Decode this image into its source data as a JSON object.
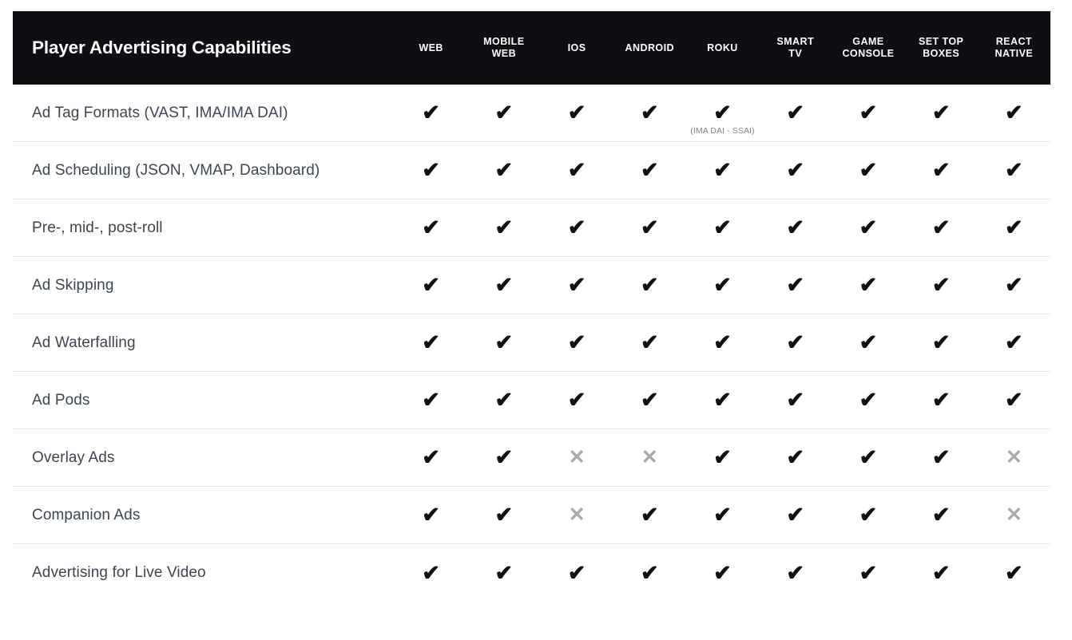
{
  "header": {
    "title": "Player Advertising Capabilities",
    "columns": [
      {
        "label": "WEB",
        "lines": [
          "WEB"
        ]
      },
      {
        "label": "MOBILE WEB",
        "lines": [
          "MOBILE",
          "WEB"
        ]
      },
      {
        "label": "IOS",
        "lines": [
          "IOS"
        ]
      },
      {
        "label": "ANDROID",
        "lines": [
          "ANDROID"
        ]
      },
      {
        "label": "ROKU",
        "lines": [
          "ROKU"
        ]
      },
      {
        "label": "SMART TV",
        "lines": [
          "SMART",
          "TV"
        ]
      },
      {
        "label": "GAME CONSOLE",
        "lines": [
          "GAME",
          "CONSOLE"
        ]
      },
      {
        "label": "SET TOP BOXES",
        "lines": [
          "SET TOP",
          "BOXES"
        ]
      },
      {
        "label": "REACT NATIVE",
        "lines": [
          "REACT",
          "NATIVE"
        ]
      }
    ],
    "background_color": "#0d0f12",
    "text_color": "#ffffff"
  },
  "icons": {
    "yes_glyph": "✔",
    "no_glyph": "✕",
    "yes_name": "check-icon",
    "no_name": "cross-icon",
    "yes_color": "#111111",
    "no_color": "#a7a9ab"
  },
  "rows": [
    {
      "label": "Ad Tag Formats (VAST, IMA/IMA DAI)",
      "cells": [
        {
          "value": "yes",
          "note": ""
        },
        {
          "value": "yes",
          "note": ""
        },
        {
          "value": "yes",
          "note": ""
        },
        {
          "value": "yes",
          "note": ""
        },
        {
          "value": "yes",
          "note": "(IMA DAI - SSAI)"
        },
        {
          "value": "yes",
          "note": ""
        },
        {
          "value": "yes",
          "note": ""
        },
        {
          "value": "yes",
          "note": ""
        },
        {
          "value": "yes",
          "note": ""
        }
      ]
    },
    {
      "label": "Ad Scheduling (JSON, VMAP, Dashboard)",
      "cells": [
        {
          "value": "yes",
          "note": ""
        },
        {
          "value": "yes",
          "note": ""
        },
        {
          "value": "yes",
          "note": ""
        },
        {
          "value": "yes",
          "note": ""
        },
        {
          "value": "yes",
          "note": ""
        },
        {
          "value": "yes",
          "note": ""
        },
        {
          "value": "yes",
          "note": ""
        },
        {
          "value": "yes",
          "note": ""
        },
        {
          "value": "yes",
          "note": ""
        }
      ]
    },
    {
      "label": "Pre-, mid-, post-roll",
      "cells": [
        {
          "value": "yes",
          "note": ""
        },
        {
          "value": "yes",
          "note": ""
        },
        {
          "value": "yes",
          "note": ""
        },
        {
          "value": "yes",
          "note": ""
        },
        {
          "value": "yes",
          "note": ""
        },
        {
          "value": "yes",
          "note": ""
        },
        {
          "value": "yes",
          "note": ""
        },
        {
          "value": "yes",
          "note": ""
        },
        {
          "value": "yes",
          "note": ""
        }
      ]
    },
    {
      "label": "Ad Skipping",
      "cells": [
        {
          "value": "yes",
          "note": ""
        },
        {
          "value": "yes",
          "note": ""
        },
        {
          "value": "yes",
          "note": ""
        },
        {
          "value": "yes",
          "note": ""
        },
        {
          "value": "yes",
          "note": ""
        },
        {
          "value": "yes",
          "note": ""
        },
        {
          "value": "yes",
          "note": ""
        },
        {
          "value": "yes",
          "note": ""
        },
        {
          "value": "yes",
          "note": ""
        }
      ]
    },
    {
      "label": "Ad Waterfalling",
      "cells": [
        {
          "value": "yes",
          "note": ""
        },
        {
          "value": "yes",
          "note": ""
        },
        {
          "value": "yes",
          "note": ""
        },
        {
          "value": "yes",
          "note": ""
        },
        {
          "value": "yes",
          "note": ""
        },
        {
          "value": "yes",
          "note": ""
        },
        {
          "value": "yes",
          "note": ""
        },
        {
          "value": "yes",
          "note": ""
        },
        {
          "value": "yes",
          "note": ""
        }
      ]
    },
    {
      "label": "Ad Pods",
      "cells": [
        {
          "value": "yes",
          "note": ""
        },
        {
          "value": "yes",
          "note": ""
        },
        {
          "value": "yes",
          "note": ""
        },
        {
          "value": "yes",
          "note": ""
        },
        {
          "value": "yes",
          "note": ""
        },
        {
          "value": "yes",
          "note": ""
        },
        {
          "value": "yes",
          "note": ""
        },
        {
          "value": "yes",
          "note": ""
        },
        {
          "value": "yes",
          "note": ""
        }
      ]
    },
    {
      "label": "Overlay Ads",
      "cells": [
        {
          "value": "yes",
          "note": ""
        },
        {
          "value": "yes",
          "note": ""
        },
        {
          "value": "no",
          "note": ""
        },
        {
          "value": "no",
          "note": ""
        },
        {
          "value": "yes",
          "note": ""
        },
        {
          "value": "yes",
          "note": ""
        },
        {
          "value": "yes",
          "note": ""
        },
        {
          "value": "yes",
          "note": ""
        },
        {
          "value": "no",
          "note": ""
        }
      ]
    },
    {
      "label": "Companion Ads",
      "cells": [
        {
          "value": "yes",
          "note": ""
        },
        {
          "value": "yes",
          "note": ""
        },
        {
          "value": "no",
          "note": ""
        },
        {
          "value": "yes",
          "note": ""
        },
        {
          "value": "yes",
          "note": ""
        },
        {
          "value": "yes",
          "note": ""
        },
        {
          "value": "yes",
          "note": ""
        },
        {
          "value": "yes",
          "note": ""
        },
        {
          "value": "no",
          "note": ""
        }
      ]
    },
    {
      "label": "Advertising for Live Video",
      "cells": [
        {
          "value": "yes",
          "note": ""
        },
        {
          "value": "yes",
          "note": ""
        },
        {
          "value": "yes",
          "note": ""
        },
        {
          "value": "yes",
          "note": ""
        },
        {
          "value": "yes",
          "note": ""
        },
        {
          "value": "yes",
          "note": ""
        },
        {
          "value": "yes",
          "note": ""
        },
        {
          "value": "yes",
          "note": ""
        },
        {
          "value": "yes",
          "note": ""
        }
      ]
    }
  ]
}
